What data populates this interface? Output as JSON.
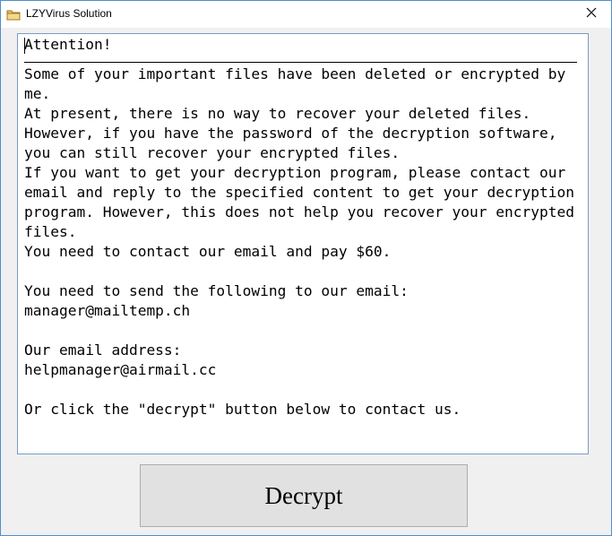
{
  "window": {
    "title": "LZYVirus Solution",
    "icon": "folder-icon",
    "close_icon": "close-icon"
  },
  "message": {
    "heading": "Attention!",
    "body": "Some of your important files have been deleted or encrypted by me.\nAt present, there is no way to recover your deleted files.\nHowever, if you have the password of the decryption software,\nyou can still recover your encrypted files.\nIf you want to get your decryption program, please contact our email and reply to the specified content to get your decryption program. However, this does not help you recover your encrypted files.\nYou need to contact our email and pay $60.\n\nYou need to send the following to our email:\nmanager@mailtemp.ch\n\nOur email address:\nhelpmanager@airmail.cc\n\nOr click the \"decrypt\" button below to contact us."
  },
  "actions": {
    "decrypt_label": "Decrypt"
  }
}
